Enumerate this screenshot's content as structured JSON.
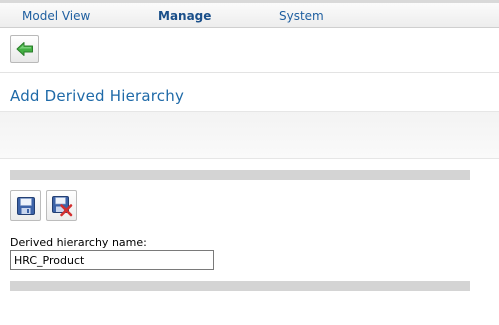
{
  "nav": {
    "tabs": [
      {
        "label": "Model View",
        "active": false
      },
      {
        "label": "Manage",
        "active": true
      },
      {
        "label": "System",
        "active": false
      }
    ]
  },
  "toolbar": {
    "back_icon": "green-left-arrow-icon"
  },
  "page": {
    "title": "Add Derived Hierarchy"
  },
  "actions": {
    "save_icon": "floppy-disk-icon",
    "save_close_icon": "floppy-disk-with-red-x-icon"
  },
  "form": {
    "name_label": "Derived hierarchy name:",
    "name_value": "HRC_Product"
  },
  "colors": {
    "accent": "#1f6aa8",
    "back_arrow": "#3aa53a",
    "close_mark": "#d32f2f",
    "separator": "#d4d4d4"
  }
}
